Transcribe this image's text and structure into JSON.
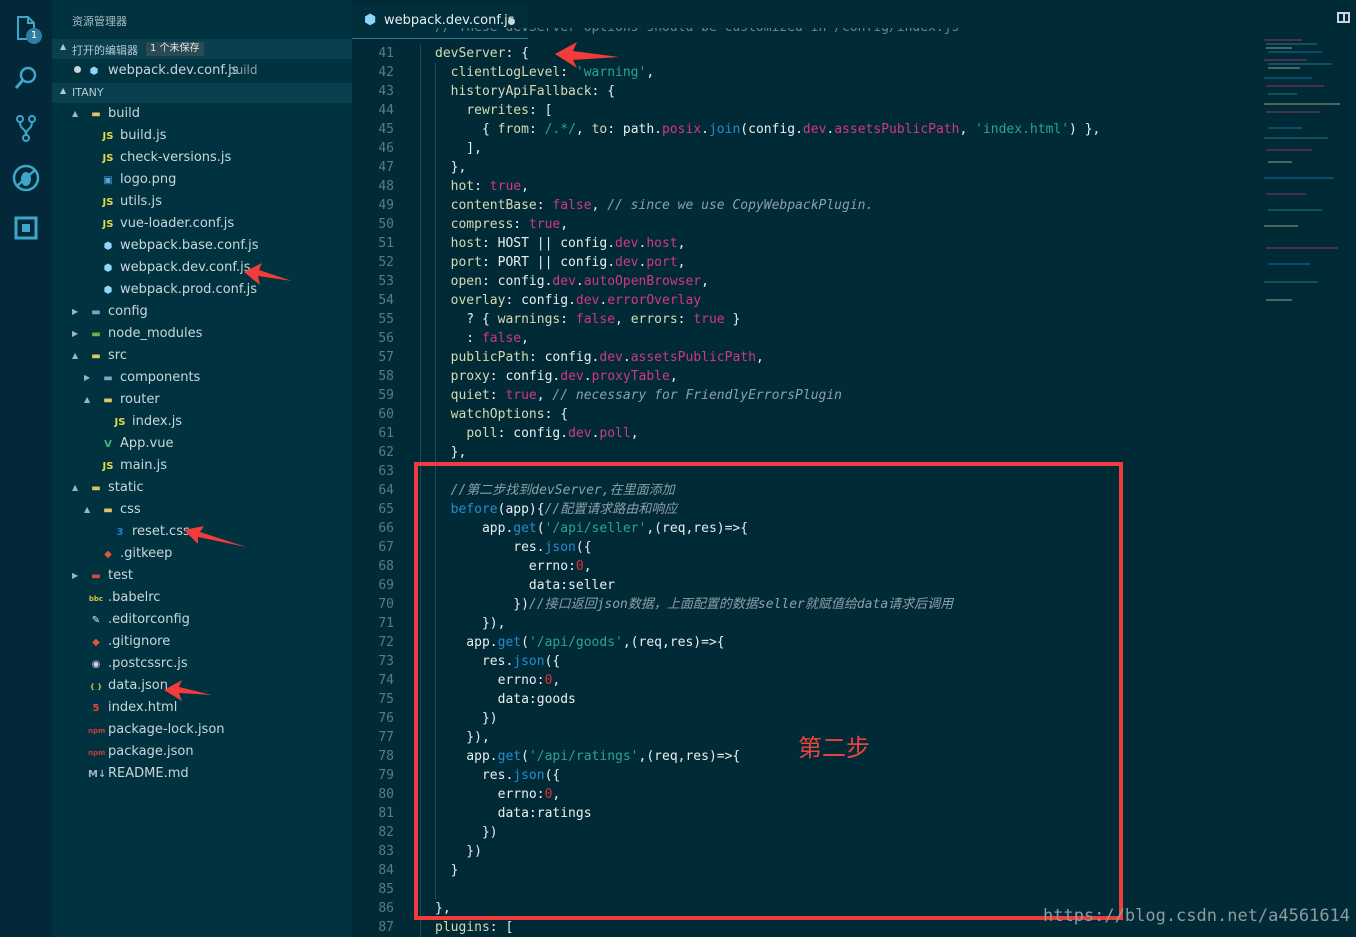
{
  "sidebar": {
    "title": "资源管理器",
    "open_editors": {
      "label": "打开的编辑器",
      "badge": "1 个未保存",
      "file": "webpack.dev.conf.js",
      "folder": "build"
    },
    "project": "ITANY",
    "tree": [
      {
        "label": "build",
        "icon": "folder-open-icon",
        "indent": 0,
        "arrow": "▲"
      },
      {
        "label": "build.js",
        "icon": "js-icon",
        "indent": 1
      },
      {
        "label": "check-versions.js",
        "icon": "js-icon",
        "indent": 1
      },
      {
        "label": "logo.png",
        "icon": "image-icon",
        "indent": 1
      },
      {
        "label": "utils.js",
        "icon": "js-icon",
        "indent": 1
      },
      {
        "label": "vue-loader.conf.js",
        "icon": "js-icon",
        "indent": 1
      },
      {
        "label": "webpack.base.conf.js",
        "icon": "webpack-icon",
        "indent": 1
      },
      {
        "label": "webpack.dev.conf.js",
        "icon": "webpack-icon",
        "indent": 1
      },
      {
        "label": "webpack.prod.conf.js",
        "icon": "webpack-icon",
        "indent": 1
      },
      {
        "label": "config",
        "icon": "folder-icon",
        "indent": 0,
        "arrow": "▶"
      },
      {
        "label": "node_modules",
        "icon": "folder-node-icon",
        "indent": 0,
        "arrow": "▶"
      },
      {
        "label": "src",
        "icon": "folder-open-icon",
        "indent": 0,
        "arrow": "▲"
      },
      {
        "label": "components",
        "icon": "folder-icon",
        "indent": 1,
        "arrow": "▶"
      },
      {
        "label": "router",
        "icon": "folder-open-icon",
        "indent": 1,
        "arrow": "▲"
      },
      {
        "label": "index.js",
        "icon": "js-icon",
        "indent": 2
      },
      {
        "label": "App.vue",
        "icon": "vue-icon",
        "indent": 1
      },
      {
        "label": "main.js",
        "icon": "js-icon",
        "indent": 1
      },
      {
        "label": "static",
        "icon": "folder-open-icon",
        "indent": 0,
        "arrow": "▲"
      },
      {
        "label": "css",
        "icon": "folder-open-icon",
        "indent": 1,
        "arrow": "▲"
      },
      {
        "label": "reset.css",
        "icon": "css-icon",
        "indent": 2
      },
      {
        "label": ".gitkeep",
        "icon": "git-icon",
        "indent": 1
      },
      {
        "label": "test",
        "icon": "folder-test-icon",
        "indent": 0,
        "arrow": "▶"
      },
      {
        "label": ".babelrc",
        "icon": "babel-icon",
        "indent": 0
      },
      {
        "label": ".editorconfig",
        "icon": "editorconfig-icon",
        "indent": 0
      },
      {
        "label": ".gitignore",
        "icon": "git-icon",
        "indent": 0
      },
      {
        "label": ".postcssrc.js",
        "icon": "postcss-icon",
        "indent": 0
      },
      {
        "label": "data.json",
        "icon": "json-icon",
        "indent": 0
      },
      {
        "label": "index.html",
        "icon": "html-icon",
        "indent": 0
      },
      {
        "label": "package-lock.json",
        "icon": "npm-icon",
        "indent": 0
      },
      {
        "label": "package.json",
        "icon": "npm-icon",
        "indent": 0
      },
      {
        "label": "README.md",
        "icon": "markdown-icon",
        "indent": 0
      }
    ]
  },
  "activity": {
    "badge": "1"
  },
  "editor": {
    "tab_label": "webpack.dev.conf.js",
    "top_partial": "// These devServer options should be customized in /config/index.js",
    "lines": [
      {
        "n": "41",
        "html": "<span class='k'>devServer</span>: {"
      },
      {
        "n": "42",
        "html": "  <span class='k'>clientLogLevel</span>: <span class='s'>'warning'</span>,"
      },
      {
        "n": "43",
        "html": "  <span class='k'>historyApiFallback</span>: {"
      },
      {
        "n": "44",
        "html": "    <span class='k'>rewrites</span>: ["
      },
      {
        "n": "45",
        "html": "      { <span class='k'>from</span>: <span class='s'>/.*/</span>, <span class='k'>to</span>: path.<span class='b'>posix</span>.<span class='m'>join</span>(config.<span class='b'>dev</span>.<span class='b'>assetsPublicPath</span>, <span class='s'>'index.html'</span>) },"
      },
      {
        "n": "46",
        "html": "    ],"
      },
      {
        "n": "47",
        "html": "  },"
      },
      {
        "n": "48",
        "html": "  <span class='k'>hot</span>: <span class='b'>true</span>,"
      },
      {
        "n": "49",
        "html": "  <span class='k'>contentBase</span>: <span class='b'>false</span>, <span class='c'>// since we use CopyWebpackPlugin.</span>"
      },
      {
        "n": "50",
        "html": "  <span class='k'>compress</span>: <span class='b'>true</span>,"
      },
      {
        "n": "51",
        "html": "  <span class='k'>host</span>: HOST || config.<span class='b'>dev</span>.<span class='b'>host</span>,"
      },
      {
        "n": "52",
        "html": "  <span class='k'>port</span>: PORT || config.<span class='b'>dev</span>.<span class='b'>port</span>,"
      },
      {
        "n": "53",
        "html": "  <span class='k'>open</span>: config.<span class='b'>dev</span>.<span class='b'>autoOpenBrowser</span>,"
      },
      {
        "n": "54",
        "html": "  <span class='k'>overlay</span>: config.<span class='b'>dev</span>.<span class='b'>errorOverlay</span>"
      },
      {
        "n": "55",
        "html": "    ? { <span class='k'>warnings</span>: <span class='b'>false</span>, <span class='k'>errors</span>: <span class='b'>true</span> }"
      },
      {
        "n": "56",
        "html": "    : <span class='b'>false</span>,"
      },
      {
        "n": "57",
        "html": "  <span class='k'>publicPath</span>: config.<span class='b'>dev</span>.<span class='b'>assetsPublicPath</span>,"
      },
      {
        "n": "58",
        "html": "  <span class='k'>proxy</span>: config.<span class='b'>dev</span>.<span class='b'>proxyTable</span>,"
      },
      {
        "n": "59",
        "html": "  <span class='k'>quiet</span>: <span class='b'>true</span>, <span class='c'>// necessary for FriendlyErrorsPlugin</span>"
      },
      {
        "n": "60",
        "html": "  <span class='k'>watchOptions</span>: {"
      },
      {
        "n": "61",
        "html": "    <span class='k'>poll</span>: config.<span class='b'>dev</span>.<span class='b'>poll</span>,"
      },
      {
        "n": "62",
        "html": "  },"
      },
      {
        "n": "63",
        "html": ""
      },
      {
        "n": "64",
        "html": "  <span class='c'>//第二步找到devServer,在里面添加</span>"
      },
      {
        "n": "65",
        "html": "  <span class='m'>before</span>(app){<span class='c'>//配置请求路由和响应</span>"
      },
      {
        "n": "66",
        "html": "      app.<span class='m'>get</span>(<span class='s'>'/api/seller'</span>,(req,res)=>{"
      },
      {
        "n": "67",
        "html": "          res.<span class='m'>json</span>({"
      },
      {
        "n": "68",
        "html": "            errno:<span class='n'>0</span>,"
      },
      {
        "n": "69",
        "html": "            data:seller"
      },
      {
        "n": "70",
        "html": "          })<span class='c'>//接口返回json数据，上面配置的数据seller就赋值给data请求后调用</span>"
      },
      {
        "n": "71",
        "html": "      }),"
      },
      {
        "n": "72",
        "html": "    app.<span class='m'>get</span>(<span class='s'>'/api/goods'</span>,(req,res)=>{"
      },
      {
        "n": "73",
        "html": "      res.<span class='m'>json</span>({"
      },
      {
        "n": "74",
        "html": "        errno:<span class='n'>0</span>,"
      },
      {
        "n": "75",
        "html": "        data:goods"
      },
      {
        "n": "76",
        "html": "      })"
      },
      {
        "n": "77",
        "html": "    }),"
      },
      {
        "n": "78",
        "html": "    app.<span class='m'>get</span>(<span class='s'>'/api/ratings'</span>,(req,res)=>{"
      },
      {
        "n": "79",
        "html": "      res.<span class='m'>json</span>({"
      },
      {
        "n": "80",
        "html": "        errno:<span class='n'>0</span>,"
      },
      {
        "n": "81",
        "html": "        data:ratings"
      },
      {
        "n": "82",
        "html": "      })"
      },
      {
        "n": "83",
        "html": "    })"
      },
      {
        "n": "84",
        "html": "  }"
      },
      {
        "n": "85",
        "html": ""
      },
      {
        "n": "86",
        "html": "},"
      },
      {
        "n": "87",
        "html": "<span class='k'>plugins</span>: ["
      }
    ]
  },
  "annotation": {
    "label": "第二步"
  },
  "watermark": "https://blog.csdn.net/a4561614",
  "colors": {
    "background": "#002b36",
    "sidebar": "#013240",
    "highlight": "#f23b3b"
  }
}
